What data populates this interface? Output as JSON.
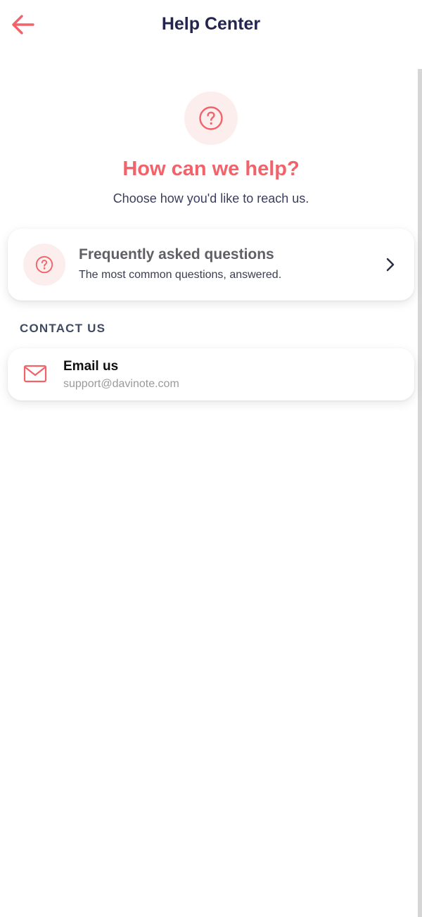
{
  "header": {
    "title": "Help Center",
    "back_icon": "arrow-left-icon"
  },
  "hero": {
    "icon": "question-circle-icon",
    "title": "How can we help?",
    "subtitle": "Choose how you'd like to reach us."
  },
  "faq": {
    "icon": "question-circle-icon",
    "title": "Frequently asked questions",
    "subtitle": "The most common questions, answered.",
    "chevron_icon": "chevron-right-icon"
  },
  "contact": {
    "section_label": "CONTACT US",
    "email": {
      "icon": "mail-icon",
      "title": "Email us",
      "address": "support@davinote.com"
    }
  },
  "colors": {
    "accent": "#f2626a",
    "accent_bg": "#fdeeee",
    "title_navy": "#23254f",
    "muted_text": "#9a9a9a"
  }
}
